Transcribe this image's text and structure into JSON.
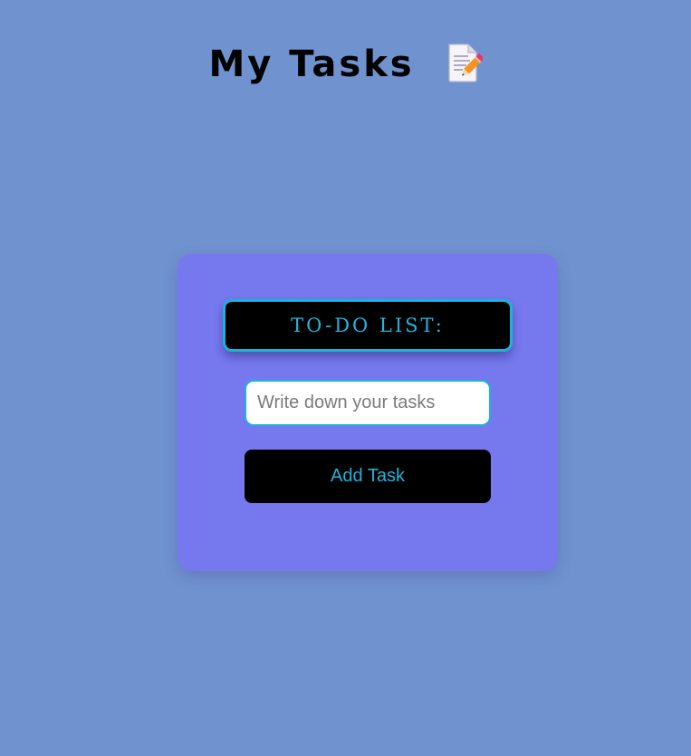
{
  "page": {
    "title": "My Tasks",
    "title_icon": "memo-icon",
    "background_color": "#7092cf"
  },
  "todo_card": {
    "heading": "TO-DO LIST:",
    "card_color": "#7678ee",
    "accent_color": "#1ab3d9",
    "task_input": {
      "value": "",
      "placeholder": "Write down your tasks"
    },
    "add_button_label": "Add Task"
  }
}
